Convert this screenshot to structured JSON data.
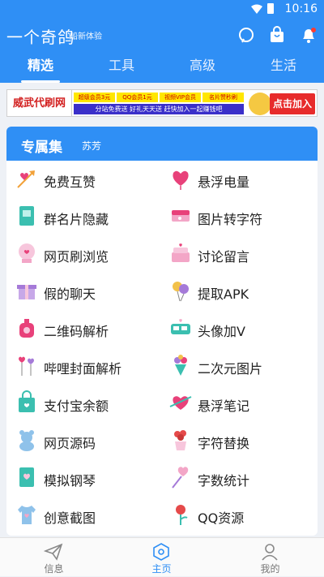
{
  "status": {
    "time": "10:16"
  },
  "app": {
    "title": "一个奇鸽",
    "subtitle": "船新体验"
  },
  "tabs": [
    {
      "label": "精选"
    },
    {
      "label": "工具"
    },
    {
      "label": "高级"
    },
    {
      "label": "生活"
    }
  ],
  "banner": {
    "left": "威武代刷网",
    "row1": [
      "超级会员3元",
      "QQ会员1元",
      "视频VIP会员",
      "名片赞秒刷"
    ],
    "row2": "分站免费送 好礼天天送 赶快加入一起赚钱吧",
    "button": "点击加入"
  },
  "section": {
    "title": "专属集",
    "subtitle": "苏芳"
  },
  "items": [
    {
      "label": "免费互赞"
    },
    {
      "label": "悬浮电量"
    },
    {
      "label": "群名片隐藏"
    },
    {
      "label": "图片转字符"
    },
    {
      "label": "网页刷浏览"
    },
    {
      "label": "讨论留言"
    },
    {
      "label": "假的聊天"
    },
    {
      "label": "提取APK"
    },
    {
      "label": "二维码解析"
    },
    {
      "label": "头像加V"
    },
    {
      "label": "哔哩封面解析"
    },
    {
      "label": "二次元图片"
    },
    {
      "label": "支付宝余额"
    },
    {
      "label": "悬浮笔记"
    },
    {
      "label": "网页源码"
    },
    {
      "label": "字符替换"
    },
    {
      "label": "模拟钢琴"
    },
    {
      "label": "字数统计"
    },
    {
      "label": "创意截图"
    },
    {
      "label": "QQ资源"
    }
  ],
  "bottom_nav": [
    {
      "label": "信息"
    },
    {
      "label": "主页"
    },
    {
      "label": "我的"
    }
  ],
  "colors": {
    "primary": "#2f8ff5",
    "background": "#eef1f6",
    "banner_button": "#e72b2b"
  }
}
